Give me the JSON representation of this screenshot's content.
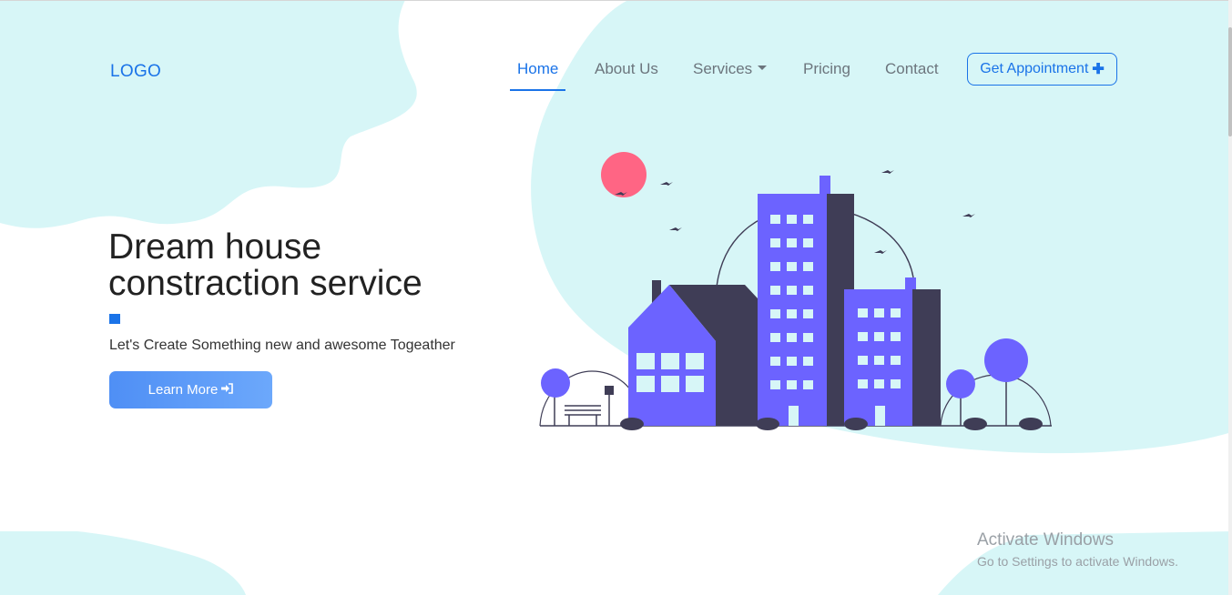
{
  "logo": "LOGO",
  "nav": {
    "items": [
      {
        "label": "Home",
        "active": true
      },
      {
        "label": "About Us"
      },
      {
        "label": "Services",
        "dropdown": true
      },
      {
        "label": "Pricing"
      },
      {
        "label": "Contact"
      }
    ],
    "cta_label": "Get Appointment",
    "cta_icon": "plus-icon"
  },
  "hero": {
    "title_line1": "Dream house",
    "title_line2": "constraction service",
    "subtitle": "Let's Create Something new and awesome Togeather",
    "button_label": "Learn More",
    "button_icon": "sign-in-icon"
  },
  "illustration": {
    "icon": "city-buildings-illustration"
  },
  "watermark": {
    "title": "Activate Windows",
    "subtitle": "Go to Settings to activate Windows."
  },
  "colors": {
    "accent": "#1a73e8",
    "blob": "#d7f6f7",
    "building": "#6c63ff",
    "building_dark": "#3f3d56",
    "sun": "#ff6584"
  }
}
